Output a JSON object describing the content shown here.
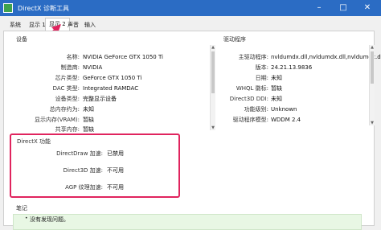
{
  "window": {
    "title": "DirectX 诊断工具"
  },
  "tabs": [
    {
      "label": "系统"
    },
    {
      "label": "显示 1"
    },
    {
      "label": "显示 2"
    },
    {
      "label": "声音"
    },
    {
      "label": "输入"
    }
  ],
  "device": {
    "title": "设备",
    "rows": [
      {
        "label": "名称:",
        "value": "NVIDIA GeForce GTX 1050 Ti"
      },
      {
        "label": "制造商:",
        "value": "NVIDIA"
      },
      {
        "label": "芯片类型:",
        "value": "GeForce GTX 1050 Ti"
      },
      {
        "label": "DAC 类型:",
        "value": "Integrated RAMDAC"
      },
      {
        "label": "设备类型:",
        "value": "完整显示设备"
      },
      {
        "label": "总内存约为:",
        "value": "未知"
      },
      {
        "label": "显示内存(VRAM):",
        "value": "暂缺"
      },
      {
        "label": "共享内存:",
        "value": "暂缺"
      }
    ]
  },
  "driver": {
    "title": "驱动程序",
    "rows": [
      {
        "label": "主驱动程序:",
        "value": "nvldumdx.dll,nvldumdx.dll,nvldumdx.dll,nvl"
      },
      {
        "label": "版本:",
        "value": "24.21.13.9836"
      },
      {
        "label": "日期:",
        "value": "未知"
      },
      {
        "label": "WHQL 徽标:",
        "value": "暂缺"
      },
      {
        "label": "Direct3D DDI:",
        "value": "未知"
      },
      {
        "label": "功能级别:",
        "value": "Unknown"
      },
      {
        "label": "驱动程序模型:",
        "value": "WDDM 2.4"
      }
    ]
  },
  "directx": {
    "title": "DirectX 功能",
    "rows": [
      {
        "label": "DirectDraw 加速:",
        "value": "已禁用"
      },
      {
        "label": "Direct3D 加速:",
        "value": "不可用"
      },
      {
        "label": "AGP 纹理加速:",
        "value": "不可用"
      }
    ]
  },
  "notes": {
    "title": "笔记",
    "item": "没有发现问题。"
  },
  "colors": {
    "highlight": "#e0245e",
    "titlebar": "#2b6cc4",
    "notes_bg": "#e8f7e4"
  }
}
